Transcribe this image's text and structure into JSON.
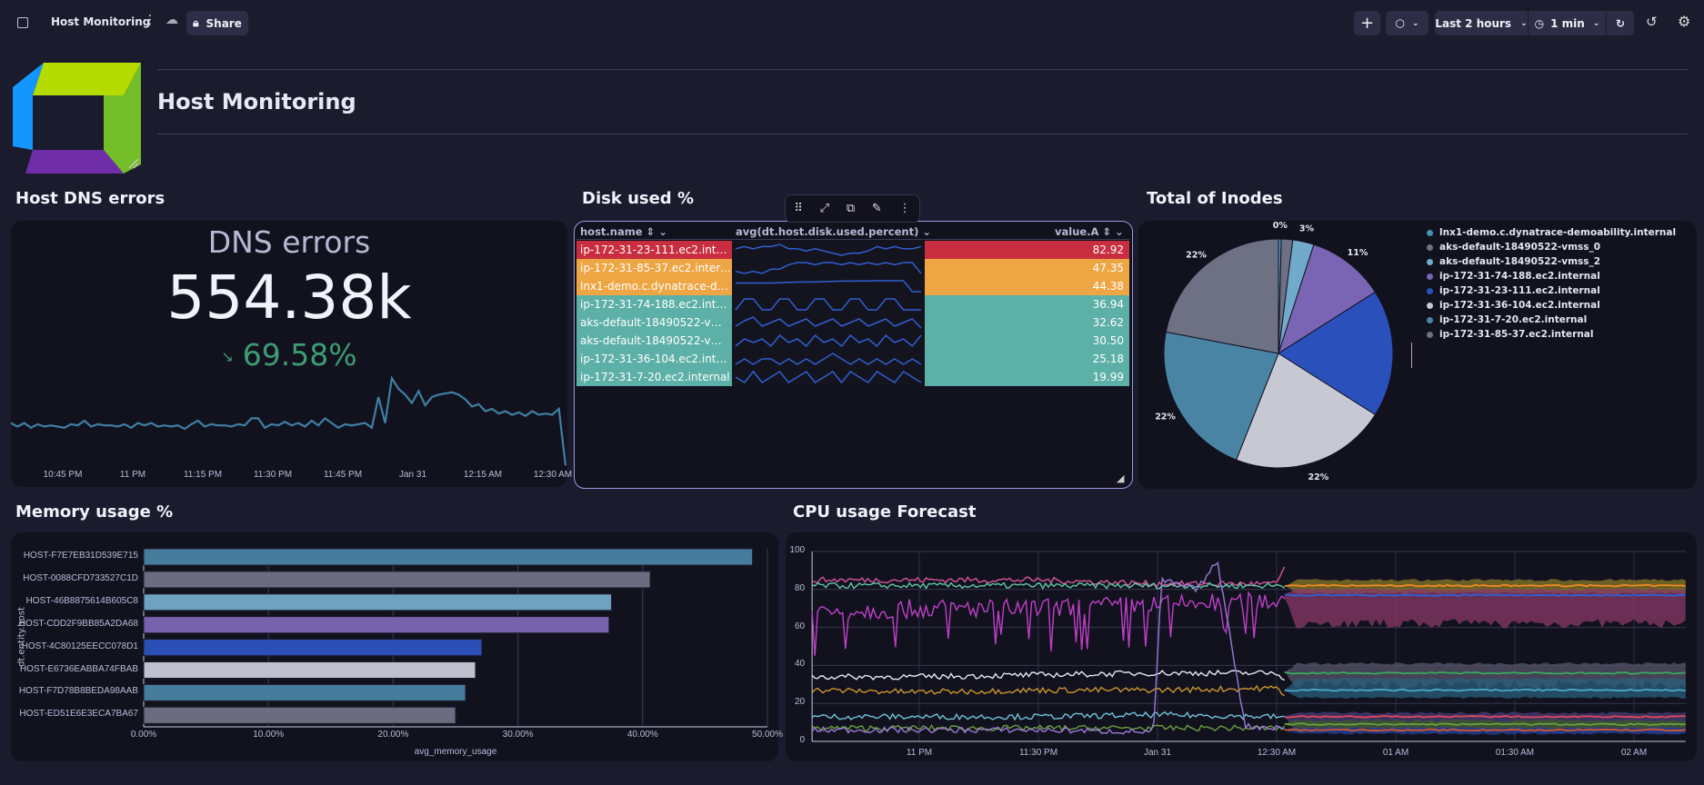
{
  "topbar": {
    "title": "Host Monitoring",
    "share_label": "Share",
    "timeframe": "Last 2 hours",
    "refresh_interval": "1 min",
    "icons": [
      "sidebar-toggle-icon",
      "more-vertical-icon",
      "cloud-sync-icon",
      "lock-icon",
      "plus-icon",
      "cube-icon",
      "chevron-down-icon",
      "clock-icon",
      "refresh-icon",
      "history-icon",
      "gear-icon"
    ]
  },
  "header": {
    "title": "Host Monitoring"
  },
  "dns": {
    "section_title": "Host DNS errors",
    "label": "DNS errors",
    "value": "554.38k",
    "change": "69.58%",
    "change_direction": "down",
    "color_change": "#3d9c72",
    "color_line": "#3f7fa3",
    "x_ticks": [
      "10:45 PM",
      "11 PM",
      "11:15 PM",
      "11:30 PM",
      "11:45 PM",
      "Jan 31",
      "12:15 AM",
      "12:30 AM"
    ],
    "sparkline": [
      38,
      35,
      38,
      34,
      37,
      35,
      36,
      35,
      34,
      37,
      36,
      40,
      35,
      37,
      36,
      36,
      35,
      37,
      34,
      38,
      36,
      38,
      35,
      36,
      35,
      36,
      33,
      37,
      40,
      35,
      37,
      36,
      36,
      35,
      37,
      36,
      42,
      42,
      34,
      37,
      36,
      39,
      36,
      38,
      35,
      40,
      36,
      42,
      38,
      34,
      37,
      36,
      37,
      38,
      34,
      60,
      38,
      76,
      67,
      62,
      55,
      65,
      53,
      60,
      62,
      63,
      64,
      62,
      58,
      52,
      54,
      48,
      50,
      46,
      48,
      45,
      47,
      44,
      48,
      45,
      46,
      45,
      50,
      2
    ]
  },
  "disk": {
    "section_title": "Disk used %",
    "columns": [
      "host.name",
      "avg(dt.host.disk.used.percent)",
      "value.A"
    ],
    "toolbar_icons": [
      "drag-handle-icon",
      "expand-icon",
      "duplicate-icon",
      "edit-icon",
      "more-vertical-icon"
    ],
    "rows": [
      {
        "host": "ip-172-31-23-111.ec2.internal",
        "value": "82.92",
        "color": "#c92e40",
        "spark": [
          5,
          6,
          5,
          6,
          6,
          7,
          5,
          5,
          4,
          5,
          4,
          3,
          2,
          3,
          3,
          4,
          6,
          5,
          6,
          5,
          5,
          6
        ]
      },
      {
        "host": "ip-172-31-85-37.ec2.internal",
        "value": "47.35",
        "color": "#eea645",
        "spark": [
          3,
          2,
          3,
          2,
          4,
          4,
          6,
          7,
          7,
          6,
          7,
          7,
          6,
          7,
          6,
          7,
          6,
          7,
          6,
          7,
          7,
          2
        ]
      },
      {
        "host": "lnx1-demo.c.dynatrace-demo…",
        "value": "44.38",
        "color": "#eea645",
        "spark": [
          5,
          5,
          5,
          5,
          5,
          5.2,
          5.4,
          5.5,
          5.6,
          5.6,
          5.8,
          6,
          6.1,
          6.1,
          6.2,
          6.2,
          6.3,
          6.3,
          6.3,
          6.3,
          0,
          0
        ]
      },
      {
        "host": "ip-172-31-74-188.ec2.internal",
        "value": "36.94",
        "color": "#5db0a7",
        "spark": [
          1,
          8,
          8,
          1,
          1,
          8,
          8,
          1,
          1,
          8,
          8,
          1,
          1,
          8,
          8,
          1,
          1,
          8,
          8,
          1,
          1,
          1
        ]
      },
      {
        "host": "aks-default-18490522-vmss_0",
        "value": "32.62",
        "color": "#5db0a7",
        "spark": [
          3,
          6,
          8,
          3,
          5,
          7,
          3,
          5,
          7,
          3,
          5,
          7,
          3,
          5,
          7,
          3,
          5,
          7,
          3,
          5,
          7,
          2
        ]
      },
      {
        "host": "aks-default-18490522-vmss_2",
        "value": "30.50",
        "color": "#5db0a7",
        "spark": [
          4,
          6,
          5,
          6,
          4,
          7,
          5,
          6,
          4,
          7,
          5,
          6,
          4,
          7,
          5,
          6,
          4,
          7,
          5,
          6,
          4,
          7
        ]
      },
      {
        "host": "ip-172-31-36-104.ec2.internal",
        "value": "25.18",
        "color": "#5db0a7",
        "spark": [
          4,
          5,
          4,
          5,
          5,
          4,
          5,
          4,
          5,
          4,
          5,
          6,
          5,
          4,
          5,
          4,
          5,
          4,
          5,
          4,
          5,
          4
        ]
      },
      {
        "host": "ip-172-31-7-20.ec2.internal",
        "value": "19.99",
        "color": "#5db0a7",
        "spark": [
          5,
          4,
          6,
          4,
          5,
          6,
          4,
          5,
          6,
          4,
          5,
          6,
          4,
          6,
          5,
          4,
          6,
          5,
          4,
          6,
          5,
          4
        ]
      }
    ]
  },
  "inodes": {
    "section_title": "Total of Inodes",
    "chart_data": {
      "type": "pie",
      "slices": [
        {
          "name": "lnx1-demo.c.dynatrace-demoability.internal",
          "value": 0.4,
          "label": "0%",
          "color": "#4a8fb0"
        },
        {
          "name": "aks-default-18490522-vmss_0",
          "value": 1.6,
          "label": "",
          "color": "#6e7084"
        },
        {
          "name": "aks-default-18490522-vmss_2",
          "value": 3,
          "label": "3%",
          "color": "#72aacb"
        },
        {
          "name": "ip-172-31-74-188.ec2.internal",
          "value": 11,
          "label": "11%",
          "color": "#7a64b4"
        },
        {
          "name": "ip-172-31-23-111.ec2.internal",
          "value": 18,
          "label": "",
          "color": "#2a50bc"
        },
        {
          "name": "ip-172-31-36-104.ec2.internal",
          "value": 22,
          "label": "22%",
          "color": "#c6c8d4"
        },
        {
          "name": "ip-172-31-7-20.ec2.internal",
          "value": 22,
          "label": "22%",
          "color": "#4a84a4"
        },
        {
          "name": "ip-172-31-85-37.ec2.internal",
          "value": 22,
          "label": "22%",
          "color": "#6e7084"
        }
      ],
      "legend": "right"
    }
  },
  "memory": {
    "section_title": "Memory usage %",
    "chart_data": {
      "type": "bar",
      "orientation": "horizontal",
      "xlabel": "avg_memory_usage",
      "ylabel": "dt.entity.host",
      "xlim": [
        0,
        50
      ],
      "x_ticks": [
        "0.00%",
        "10.00%",
        "20.00%",
        "30.00%",
        "40.00%",
        "50.00%"
      ],
      "categories": [
        "HOST-F7E7EB31D539E715",
        "HOST-0088CFD733527C1D",
        "HOST-46B8875614B605C8",
        "HOST-CDD2F9BB85A2DA68",
        "HOST-4C80125EECC078D1",
        "HOST-E6736EABBA74FBAB",
        "HOST-F7D78B8BEDA98AAB",
        "HOST-ED51E6E3ECA7BA67"
      ],
      "values": [
        48.8,
        40.6,
        37.5,
        37.3,
        27.1,
        26.6,
        25.8,
        25.0
      ],
      "colors": [
        "#467c9c",
        "#6b6c80",
        "#6fa1c0",
        "#7762ad",
        "#2a50b8",
        "#bfc1ce",
        "#467c9c",
        "#6b6c80"
      ],
      "grid": true
    }
  },
  "cpu": {
    "section_title": "CPU usage Forecast",
    "chart_data": {
      "type": "line",
      "ylim": [
        0,
        100
      ],
      "y_ticks": [
        "0",
        "20",
        "40",
        "60",
        "80",
        "100"
      ],
      "x_ticks": [
        {
          "t": "23:00",
          "label": "11 PM"
        },
        {
          "t": "23:30",
          "label": "11:30 PM"
        },
        {
          "t": "00:00",
          "label": "Jan 31"
        },
        {
          "t": "00:30",
          "label": "12:30 AM"
        },
        {
          "t": "01:00",
          "label": "01 AM"
        },
        {
          "t": "01:30",
          "label": "01:30 AM"
        },
        {
          "t": "02:00",
          "label": "02 AM"
        }
      ],
      "x_range": [
        "22:33",
        "02:13"
      ],
      "forecast_start": "00:32",
      "grid": true,
      "series": [
        {
          "color": "#d9559a",
          "times": [
            "22:33",
            "23:00",
            "23:30",
            "00:00",
            "00:30",
            "00:32"
          ],
          "values": [
            85,
            85,
            85,
            83,
            83,
            92
          ]
        },
        {
          "color": "#5fc9a8",
          "times": [
            "22:33",
            "23:00",
            "23:30",
            "00:00",
            "00:30",
            "00:32"
          ],
          "values": [
            82,
            82,
            82,
            82,
            82,
            82
          ]
        },
        {
          "color": "#c040c8",
          "times": [
            "22:33",
            "23:00",
            "23:30",
            "00:00",
            "00:30",
            "00:32"
          ],
          "values": [
            68,
            70,
            70,
            72,
            74,
            78
          ]
        },
        {
          "color": "#e8e8f2",
          "times": [
            "22:33",
            "23:00",
            "23:30",
            "00:00",
            "00:30",
            "00:32"
          ],
          "values": [
            34,
            34,
            35,
            36,
            36,
            33
          ]
        },
        {
          "color": "#c9962b",
          "times": [
            "22:33",
            "23:00",
            "23:30",
            "00:00",
            "00:30",
            "00:32"
          ],
          "values": [
            27,
            26,
            27,
            27,
            28,
            25
          ]
        },
        {
          "color": "#6ec3d8",
          "times": [
            "22:33",
            "23:00",
            "23:30",
            "00:00",
            "00:30",
            "00:32"
          ],
          "values": [
            13,
            13,
            13,
            14,
            13,
            13
          ]
        },
        {
          "color": "#6aa03a",
          "times": [
            "22:33",
            "23:00",
            "23:30",
            "00:00",
            "00:30",
            "00:32"
          ],
          "values": [
            7,
            7,
            7,
            7,
            7,
            7
          ]
        },
        {
          "color": "#9a7ad8",
          "times": [
            "22:33",
            "23:30",
            "23:59",
            "00:01",
            "00:10",
            "00:15",
            "00:18",
            "00:22",
            "00:32"
          ],
          "values": [
            6,
            6,
            5,
            85,
            80,
            95,
            60,
            8,
            7
          ]
        }
      ],
      "forecast": [
        {
          "lower": 78,
          "upper": 85,
          "mean": 82,
          "band_color": "#8a7a2a",
          "mean_color": "#f08a24"
        },
        {
          "lower": 62,
          "upper": 80,
          "mean": 77,
          "band_color": "#8a3868",
          "mean_color": "#2f62d8"
        },
        {
          "lower": 30,
          "upper": 41,
          "mean": 36,
          "band_color": "#55566a",
          "mean_color": "#3aa860"
        },
        {
          "lower": 23,
          "upper": 33,
          "mean": 27,
          "band_color": "#2a5f7c",
          "mean_color": "#4aa8c8"
        },
        {
          "lower": 5,
          "upper": 15,
          "mean": 13,
          "band_color": "#4a3e78",
          "mean_color": "#e04858"
        },
        {
          "lower": 7,
          "upper": 11,
          "mean": 9,
          "band_color": "#3c5a2a",
          "mean_color": "#6aa03a"
        },
        {
          "lower": 4,
          "upper": 7,
          "mean": 6,
          "band_color": "#24409a",
          "mean_color": "#d0582a"
        }
      ]
    }
  }
}
